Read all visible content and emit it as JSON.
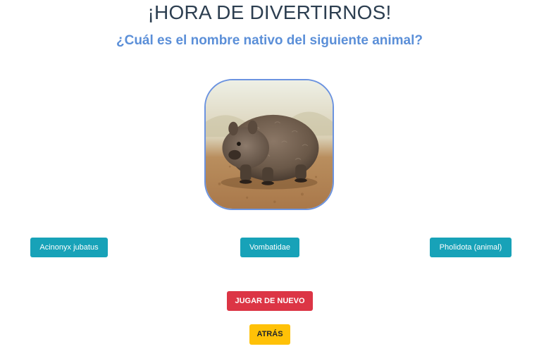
{
  "game": {
    "title": "¡HORA DE DIVERTIRNOS!",
    "question": "¿Cuál es el nombre nativo del siguiente animal?"
  },
  "image": {
    "subject": "wombat"
  },
  "answers": [
    {
      "label": "Acinonyx jubatus"
    },
    {
      "label": "Vombatidae"
    },
    {
      "label": "Pholidota (animal)"
    }
  ],
  "actions": {
    "play_again_label": "JUGAR DE NUEVO",
    "back_label": "ATRÁS"
  },
  "colors": {
    "title": "#2c3e50",
    "question": "#5b8fd8",
    "answer_button": "#17a2b8",
    "play_again_button": "#dc3545",
    "back_button": "#ffc107",
    "image_border": "#6b93e0"
  }
}
